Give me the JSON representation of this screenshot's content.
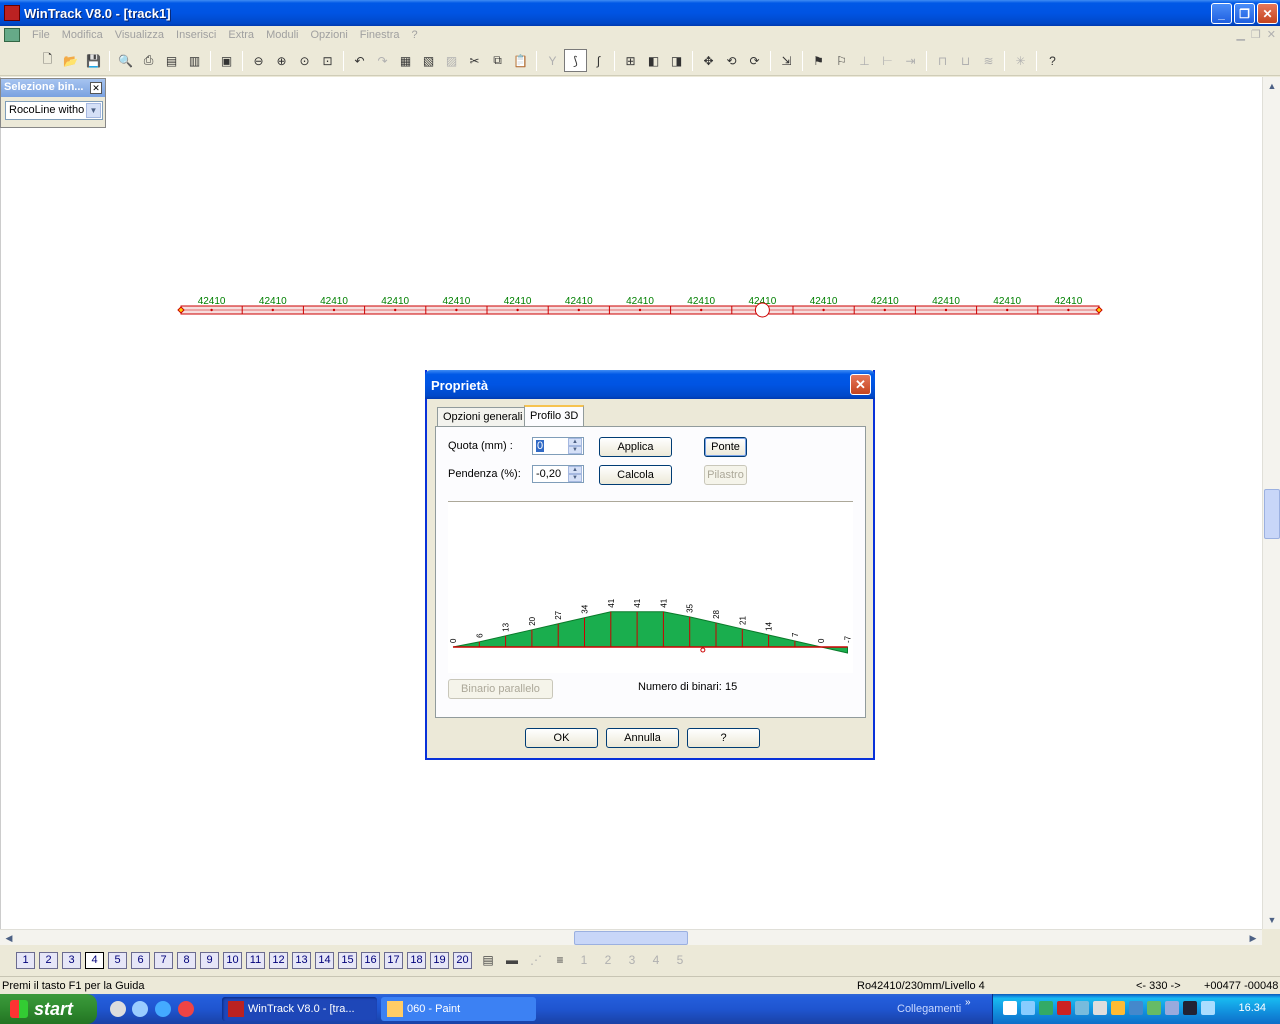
{
  "window": {
    "title": "WinTrack  V8.0 - [track1]"
  },
  "menu": [
    "File",
    "Modifica",
    "Visualizza",
    "Inserisci",
    "Extra",
    "Moduli",
    "Opzioni",
    "Finestra",
    "?"
  ],
  "palette": {
    "title": "Selezione bin...",
    "selected": "RocoLine witho"
  },
  "track": {
    "labels": [
      "42410",
      "42410",
      "42410",
      "42410",
      "42410",
      "42410",
      "42410",
      "42410",
      "42410",
      "42410",
      "42410",
      "42410",
      "42410",
      "42410",
      "42410"
    ],
    "colors": {
      "line": "#cc0000",
      "label": "#008000"
    }
  },
  "dialog": {
    "title": "Proprietà",
    "tabs": [
      "Opzioni generali",
      "Profilo 3D"
    ],
    "quota_label": "Quota (mm) :",
    "quota_value": "0",
    "pendenza_label": "Pendenza (%):",
    "pendenza_value": "-0,20",
    "applica": "Applica",
    "calcola": "Calcola",
    "ponte": "Ponte",
    "pilastro": "Pilastro",
    "binario_parallelo": "Binario parallelo",
    "numero_label": "Numero di binari:",
    "numero_value": "15",
    "ok": "OK",
    "annulla": "Annulla",
    "help": "?",
    "profile_heights": [
      0,
      6,
      13,
      20,
      27,
      34,
      41,
      41,
      41,
      35,
      28,
      21,
      14,
      7,
      0,
      -7
    ],
    "profile_fill": "#1aae4e"
  },
  "layers": [
    "1",
    "2",
    "3",
    "4",
    "5",
    "6",
    "7",
    "8",
    "9",
    "10",
    "11",
    "12",
    "13",
    "14",
    "15",
    "16",
    "17",
    "18",
    "19",
    "20"
  ],
  "active_layer": "4",
  "status": {
    "hint": "Premi il tasto F1 per la Guida",
    "info": "Ro42410/230mm/Livello 4",
    "coord1": "<- 330 ->",
    "coord2": "+00477 -00048"
  },
  "taskbar": {
    "start": "start",
    "tasks": [
      "WinTrack  V8.0 - [tra...",
      "060 - Paint"
    ],
    "links": "Collegamenti",
    "clock": "16.34"
  }
}
